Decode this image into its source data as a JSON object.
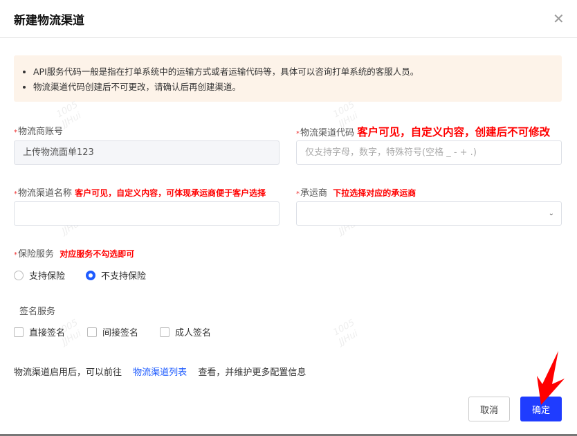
{
  "dialog": {
    "title": "新建物流渠道",
    "close_icon": "close-icon"
  },
  "notice": [
    "API服务代码一般是指在打单系统中的运输方式或者运输代码等，具体可以咨询打单系统的客服人员。",
    "物流渠道代码创建后不可更改，请确认后再创建渠道。"
  ],
  "form": {
    "account": {
      "label": "物流商账号",
      "value": "上传物流面单123"
    },
    "code": {
      "label": "物流渠道代码",
      "note": "客户可见，自定义内容，创建后不可修改",
      "placeholder": "仅支持字母，数字，特殊符号(空格 _ - + .)"
    },
    "name": {
      "label": "物流渠道名称",
      "note": "客户可见，自定义内容，可体现承运商便于客户选择",
      "value": ""
    },
    "carrier": {
      "label": "承运商",
      "note": "下拉选择对应的承运商",
      "value": ""
    },
    "insurance": {
      "label": "保险服务",
      "note": "对应服务不勾选即可",
      "options": [
        {
          "label": "支持保险",
          "selected": false
        },
        {
          "label": "不支持保险",
          "selected": true
        }
      ]
    },
    "signature": {
      "label": "签名服务",
      "options": [
        {
          "label": "直接签名",
          "checked": false
        },
        {
          "label": "间接签名",
          "checked": false
        },
        {
          "label": "成人签名",
          "checked": false
        }
      ]
    },
    "required_mark": "*"
  },
  "footer": {
    "text_before": "物流渠道启用后，可以前往",
    "link": "物流渠道列表",
    "text_after": "查看，并维护更多配置信息",
    "cancel": "取消",
    "confirm": "确定"
  },
  "watermark": {
    "line1": "1005",
    "line2": "JJHui"
  },
  "colors": {
    "primary": "#1f5cff",
    "annotation": "#ff0000",
    "notice_bg": "#fdf3e9"
  }
}
